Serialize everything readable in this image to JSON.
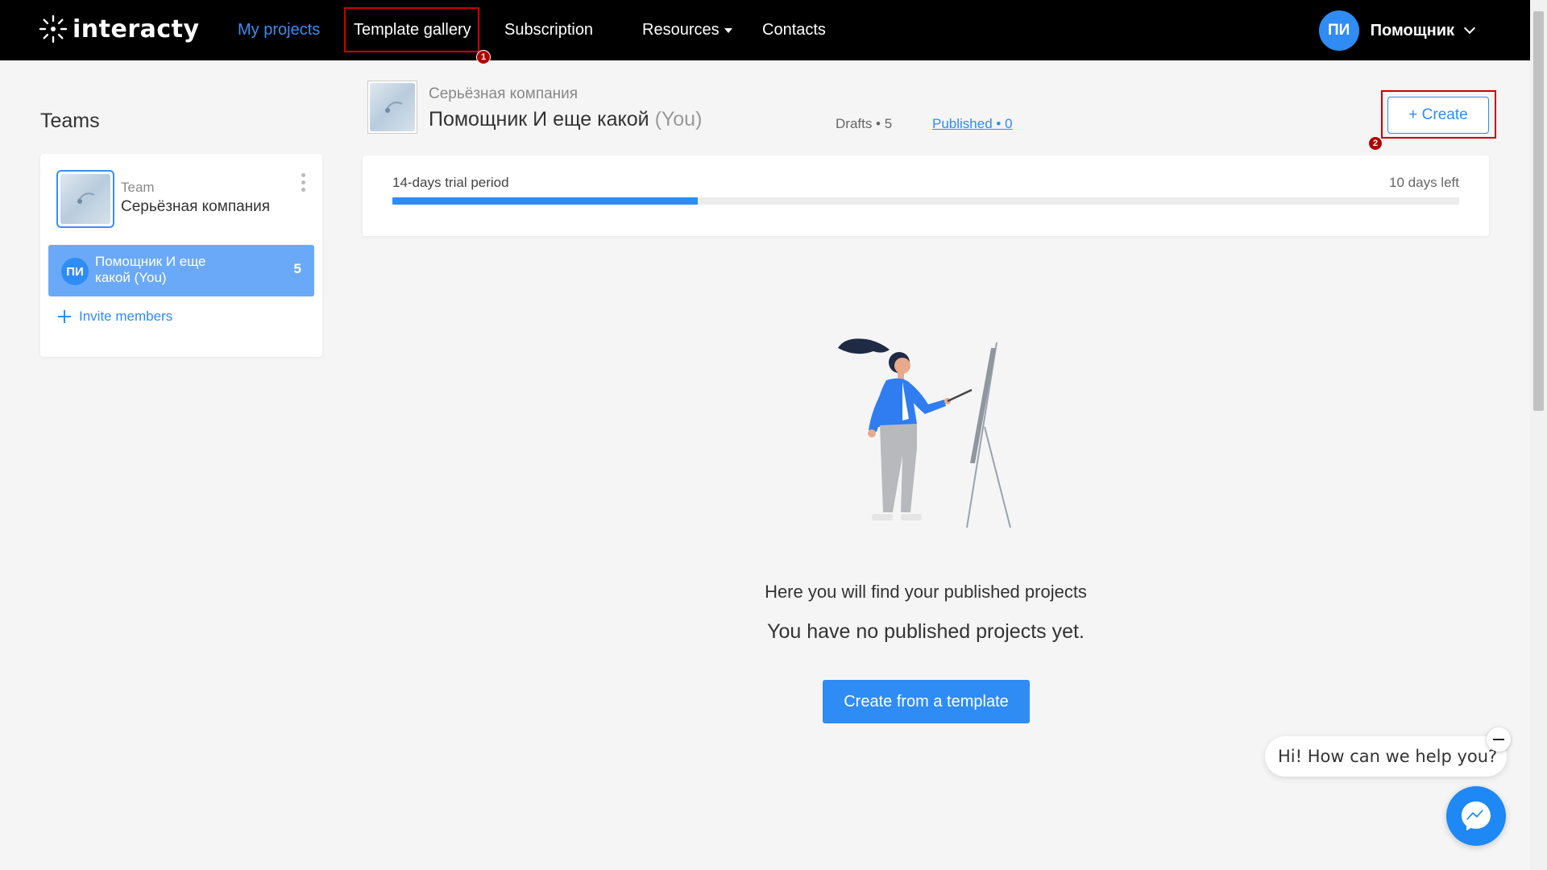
{
  "brand": {
    "name": "interacty"
  },
  "nav": {
    "items": [
      {
        "label": "My projects",
        "active": true
      },
      {
        "label": "Template gallery",
        "highlight_marker": "1"
      },
      {
        "label": "Subscription"
      },
      {
        "label": "Resources",
        "has_dropdown": true
      },
      {
        "label": "Contacts"
      }
    ]
  },
  "user": {
    "initials": "ПИ",
    "name": "Помощник"
  },
  "teams": {
    "title": "Teams",
    "team_label": "Team",
    "team_name": "Серьёзная компания",
    "member": {
      "initials": "ПИ",
      "name": "Помощник И еще какой (You)",
      "count": "5"
    },
    "invite_label": "Invite members"
  },
  "header": {
    "org_name": "Серьёзная компания",
    "user_name": "Помощник И еще какой",
    "you_suffix": "(You)",
    "tabs": {
      "drafts": "Drafts • 5",
      "published": "Published  • 0"
    },
    "create_label": "+ Create",
    "create_marker": "2"
  },
  "trial": {
    "title": "14-days trial period",
    "remaining": "10 days left",
    "progress_fraction": 0.286
  },
  "empty_state": {
    "title": "Here you will find your published projects",
    "subtitle": "You have no published projects yet.",
    "button_label": "Create from a template"
  },
  "chat": {
    "greeting": "Hi! How can we help you?"
  },
  "colors": {
    "accent": "#2f8cf5",
    "highlight": "#cc0000",
    "nav_bg": "#000000"
  },
  "icons": {
    "logo": "interacty-logo-icon",
    "chevron": "chevron-down-icon",
    "plus": "plus-icon",
    "kebab": "more-vertical-icon",
    "messenger": "messenger-icon",
    "minimize": "minimize-icon"
  }
}
